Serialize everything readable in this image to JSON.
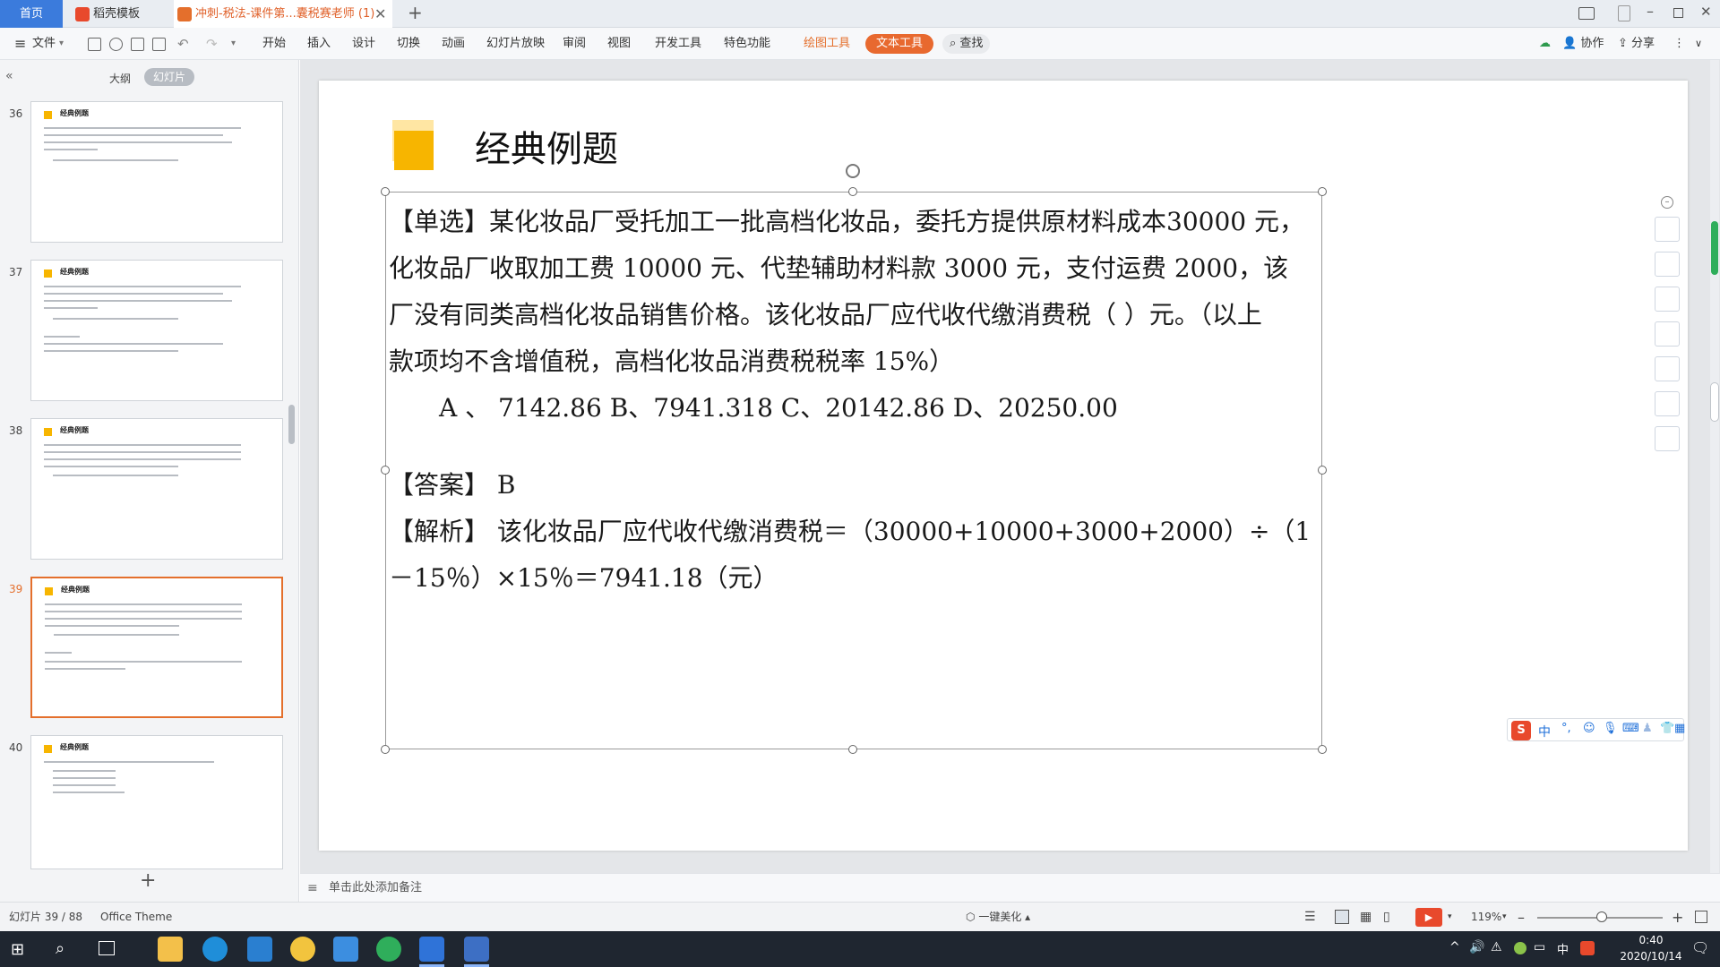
{
  "tabs": {
    "home": "首页",
    "template": "稻壳模板",
    "document": "冲刺-税法-课件第...囊税赛老师 (1)",
    "new_tab": "+"
  },
  "menu": {
    "file": "文件",
    "items": [
      "开始",
      "插入",
      "设计",
      "切换",
      "动画",
      "幻灯片放映",
      "审阅",
      "视图",
      "开发工具",
      "特色功能"
    ],
    "drawing_tools": "绘图工具",
    "text_tools": "文本工具",
    "search": "查找",
    "collaborate": "协作",
    "share": "分享"
  },
  "left_panel": {
    "tab_outline": "大纲",
    "tab_slides": "幻灯片",
    "add_slide": "+",
    "thumbnails": [
      {
        "num": "36",
        "title": "经典例题"
      },
      {
        "num": "37",
        "title": "经典例题"
      },
      {
        "num": "38",
        "title": "经典例题"
      },
      {
        "num": "39",
        "title": "经典例题"
      },
      {
        "num": "40",
        "title": "经典例题"
      }
    ]
  },
  "slide": {
    "title": "经典例题",
    "question_lines": [
      "【单选】某化妆品厂受托加工一批高档化妆品，委托方提供原材料成本30000 元，",
      "化妆品厂收取加工费 10000 元、代垫辅助材料款 3000 元，支付运费 2000，该",
      "厂没有同类高档化妆品销售价格。该化妆品厂应代收代缴消费税（ ）元。（以上",
      "款项均不含增值税，高档化妆品消费税税率 15%）"
    ],
    "options": "A 、 7142.86  B、7941.318  C、20142.86  D、20250.00",
    "answer": "【答案】 B",
    "analysis_lines": [
      "【解析】 该化妆品厂应代收代缴消费税＝（30000+10000+3000+2000）÷（1",
      "－15％）×15％＝7941.18（元）"
    ]
  },
  "notes_placeholder": "单击此处添加备注",
  "status": {
    "slide_counter": "幻灯片 39 / 88",
    "theme": "Office Theme",
    "beautify": "一键美化",
    "zoom": "119%"
  },
  "ime": {
    "lang": "中"
  },
  "taskbar": {
    "time": "0:40",
    "date": "2020/10/14",
    "ime": "中"
  },
  "colors": {
    "accent_orange": "#e46f2c",
    "title_square": "#f7b500",
    "home_tab_blue": "#3b7bdc"
  }
}
